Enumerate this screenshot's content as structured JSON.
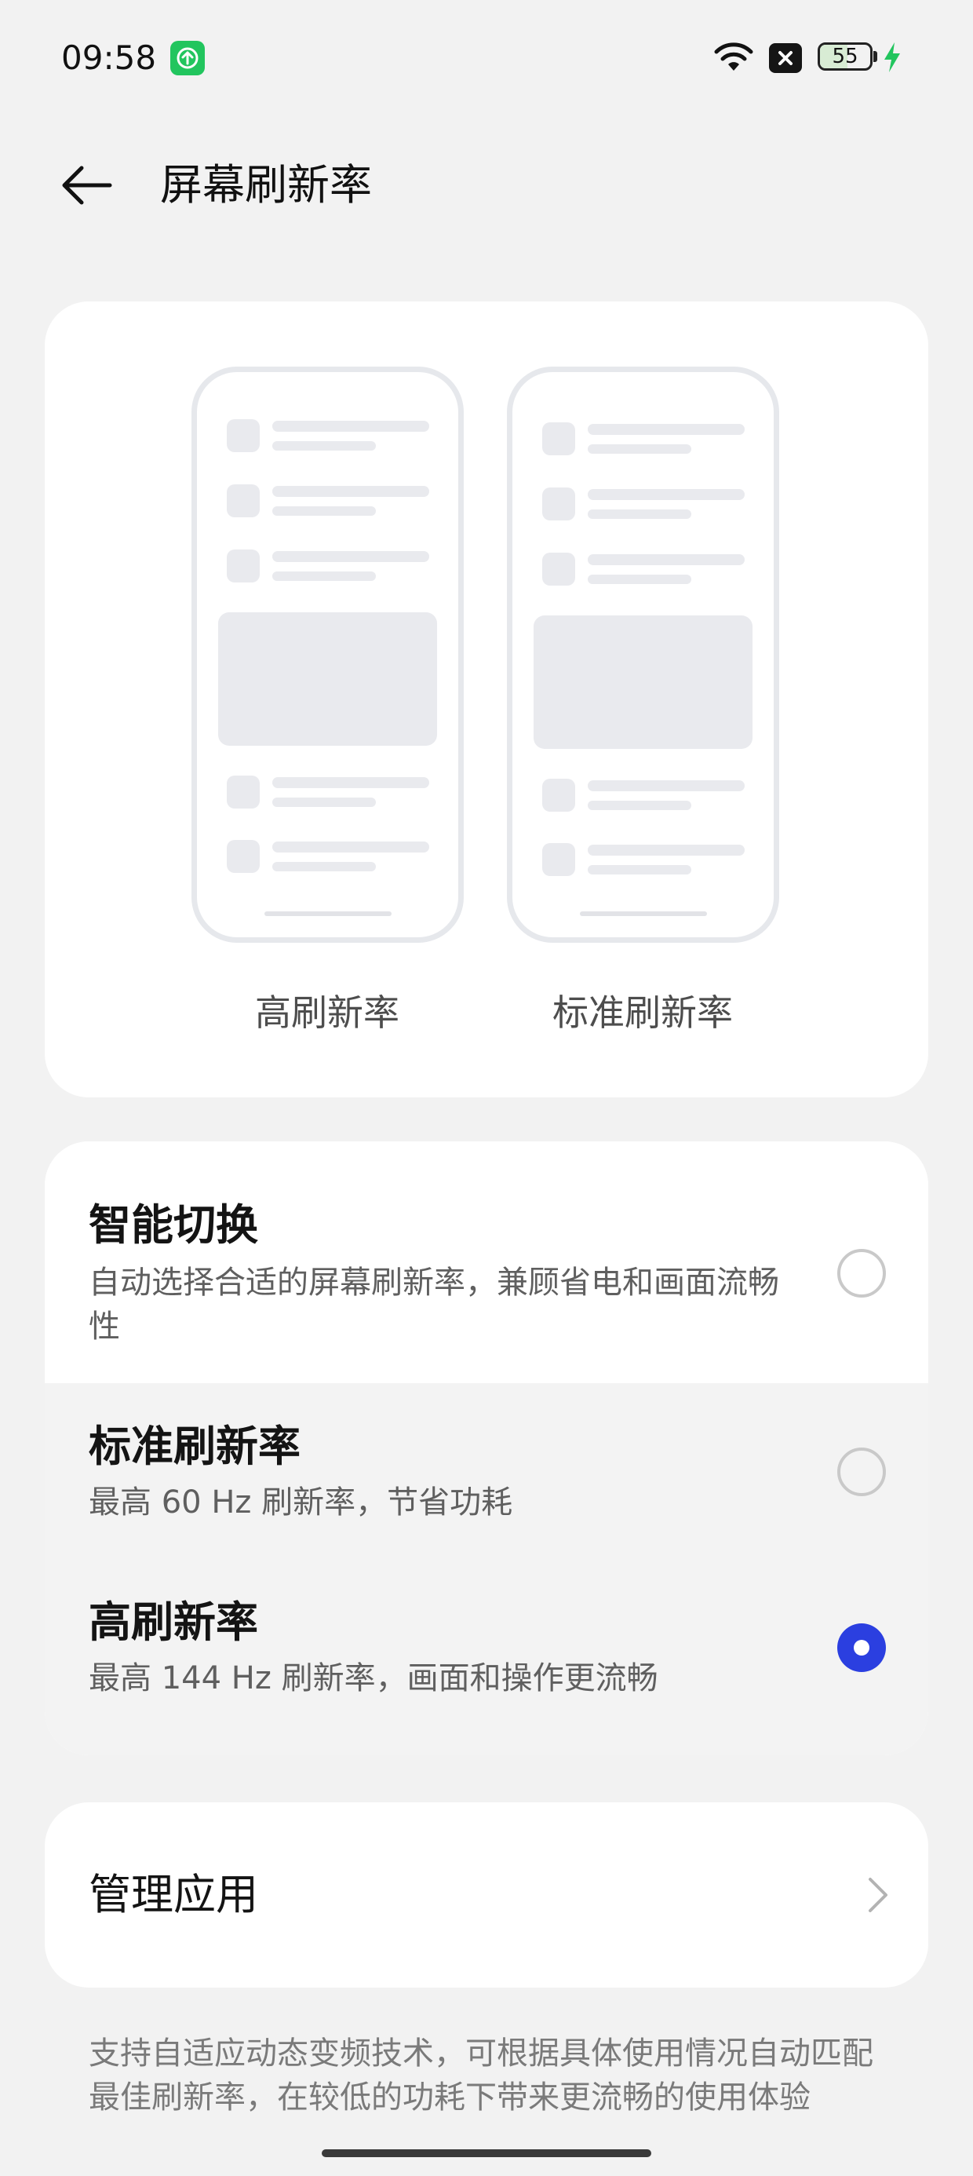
{
  "status_bar": {
    "time": "09:58",
    "battery_level": "55",
    "battery_fraction": 0.55,
    "icons": [
      "app-update-icon",
      "wifi-icon",
      "no-sim-icon",
      "battery-icon",
      "charging-bolt-icon"
    ]
  },
  "header": {
    "title": "屏幕刷新率",
    "back_icon": "arrow-left-icon"
  },
  "preview": {
    "high_label": "高刷新率",
    "standard_label": "标准刷新率"
  },
  "options": [
    {
      "title": "智能切换",
      "description": "自动选择合适的屏幕刷新率，兼顾省电和画面流畅性",
      "selected": false
    },
    {
      "title": "标准刷新率",
      "description": "最高 60 Hz 刷新率，节省功耗",
      "selected": false
    },
    {
      "title": "高刷新率",
      "description": "最高 144 Hz 刷新率，画面和操作更流畅",
      "selected": true
    }
  ],
  "manage": {
    "label": "管理应用",
    "icon": "chevron-right-icon"
  },
  "footer": {
    "note": "支持自适应动态变频技术，可根据具体使用情况自动匹配最佳刷新率，在较低的功耗下带来更流畅的使用体验"
  },
  "colors": {
    "accent": "#2b3fe0",
    "background": "#f2f2f2",
    "card": "#ffffff",
    "charging": "#22c55e"
  }
}
